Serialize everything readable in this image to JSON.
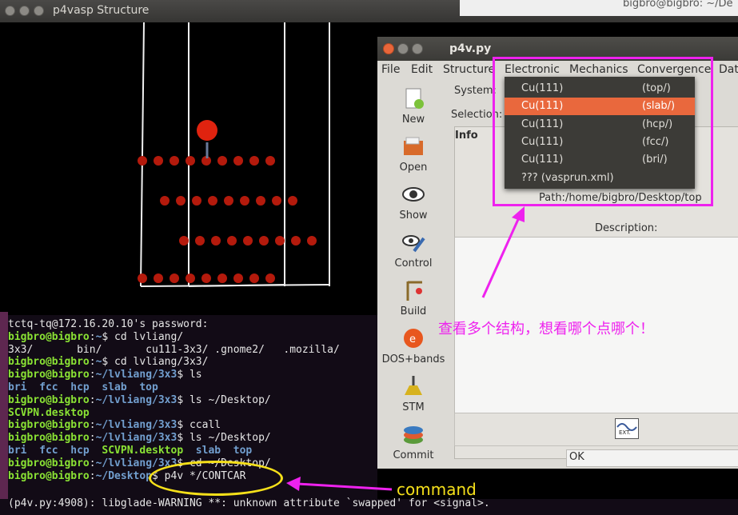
{
  "structure_window": {
    "title": "p4vasp Structure"
  },
  "top_right_title": "bigbro@bigbro: ~/De",
  "terminal": {
    "lines": [
      {
        "parts": [
          {
            "t": "tctq-tq@172.16.20.10's password:",
            "c": "w"
          }
        ]
      },
      {
        "parts": [
          {
            "t": "bigbro@bigbro",
            "c": "g"
          },
          {
            "t": ":",
            "c": "w"
          },
          {
            "t": "~",
            "c": "b"
          },
          {
            "t": "$ cd lvliang/",
            "c": "w"
          }
        ]
      },
      {
        "parts": [
          {
            "t": "3x3/       bin/       cu111-3x3/ .gnome2/   .mozilla/",
            "c": "w"
          }
        ]
      },
      {
        "parts": [
          {
            "t": "bigbro@bigbro",
            "c": "g"
          },
          {
            "t": ":",
            "c": "w"
          },
          {
            "t": "~",
            "c": "b"
          },
          {
            "t": "$ cd lvliang/3x3/",
            "c": "w"
          }
        ]
      },
      {
        "parts": [
          {
            "t": "bigbro@bigbro",
            "c": "g"
          },
          {
            "t": ":",
            "c": "w"
          },
          {
            "t": "~/lvliang/3x3",
            "c": "b"
          },
          {
            "t": "$ ls",
            "c": "w"
          }
        ]
      },
      {
        "parts": [
          {
            "t": "bri  fcc  hcp  slab  top",
            "c": "b"
          }
        ]
      },
      {
        "parts": [
          {
            "t": "bigbro@bigbro",
            "c": "g"
          },
          {
            "t": ":",
            "c": "w"
          },
          {
            "t": "~/lvliang/3x3",
            "c": "b"
          },
          {
            "t": "$ ls ~/Desktop/",
            "c": "w"
          }
        ]
      },
      {
        "parts": [
          {
            "t": "SCVPN.desktop",
            "c": "g"
          }
        ]
      },
      {
        "parts": [
          {
            "t": "bigbro@bigbro",
            "c": "g"
          },
          {
            "t": ":",
            "c": "w"
          },
          {
            "t": "~/lvliang/3x3",
            "c": "b"
          },
          {
            "t": "$ ccall",
            "c": "w"
          }
        ]
      },
      {
        "parts": [
          {
            "t": "bigbro@bigbro",
            "c": "g"
          },
          {
            "t": ":",
            "c": "w"
          },
          {
            "t": "~/lvliang/3x3",
            "c": "b"
          },
          {
            "t": "$ ls ~/Desktop/",
            "c": "w"
          }
        ]
      },
      {
        "parts": [
          {
            "t": "bri  fcc  hcp  ",
            "c": "b"
          },
          {
            "t": "SCVPN.desktop",
            "c": "g"
          },
          {
            "t": "  slab  top",
            "c": "b"
          }
        ]
      },
      {
        "parts": [
          {
            "t": "bigbro@bigbro",
            "c": "g"
          },
          {
            "t": ":",
            "c": "w"
          },
          {
            "t": "~/lvliang/3x3",
            "c": "b"
          },
          {
            "t": "$ cd ~/Desktop/",
            "c": "w"
          }
        ]
      },
      {
        "parts": [
          {
            "t": "bigbro@bigbro",
            "c": "g"
          },
          {
            "t": ":",
            "c": "w"
          },
          {
            "t": "~/Desktop",
            "c": "b"
          },
          {
            "t": "$ p4v */CONTCAR",
            "c": "w"
          }
        ]
      },
      {
        "parts": [
          {
            "t": "",
            "c": "w"
          }
        ]
      },
      {
        "parts": [
          {
            "t": "(p4v.py:4908): libglade-WARNING **: unknown attribute `swapped' for <signal>.",
            "c": "w"
          }
        ]
      }
    ]
  },
  "p4v": {
    "title": "p4v.py",
    "menu": [
      "File",
      "Edit",
      "Structure",
      "Electronic",
      "Mechanics",
      "Convergence",
      "Dat"
    ],
    "tools": [
      "New",
      "Open",
      "Show",
      "Control",
      "Build",
      "DOS+bands",
      "STM",
      "Commit"
    ],
    "system_label": "System:",
    "selection_label": "Selection:",
    "info_label": "Info",
    "path_text": "Path:/home/bigbro/Desktop/top",
    "description_label": "Description:",
    "ok_text": "OK",
    "ext_label": "EXT."
  },
  "dropdown": {
    "items": [
      {
        "name": "Cu(111)",
        "path": "(top/)",
        "selected": false
      },
      {
        "name": "Cu(111)",
        "path": "(slab/)",
        "selected": true
      },
      {
        "name": "Cu(111)",
        "path": "(hcp/)",
        "selected": false
      },
      {
        "name": "Cu(111)",
        "path": "(fcc/)",
        "selected": false
      },
      {
        "name": "Cu(111)",
        "path": "(bri/)",
        "selected": false
      },
      {
        "name": "??? (vasprun.xml)",
        "path": "",
        "selected": false
      }
    ]
  },
  "annotations": {
    "chinese_note": "查看多个结构，想看哪个点哪个！",
    "command_note": "command"
  },
  "colors": {
    "highlight": "#e9683d",
    "annotation_magenta": "#ee22ee",
    "annotation_yellow": "#f5e01a",
    "atom": "#b41a0c"
  }
}
